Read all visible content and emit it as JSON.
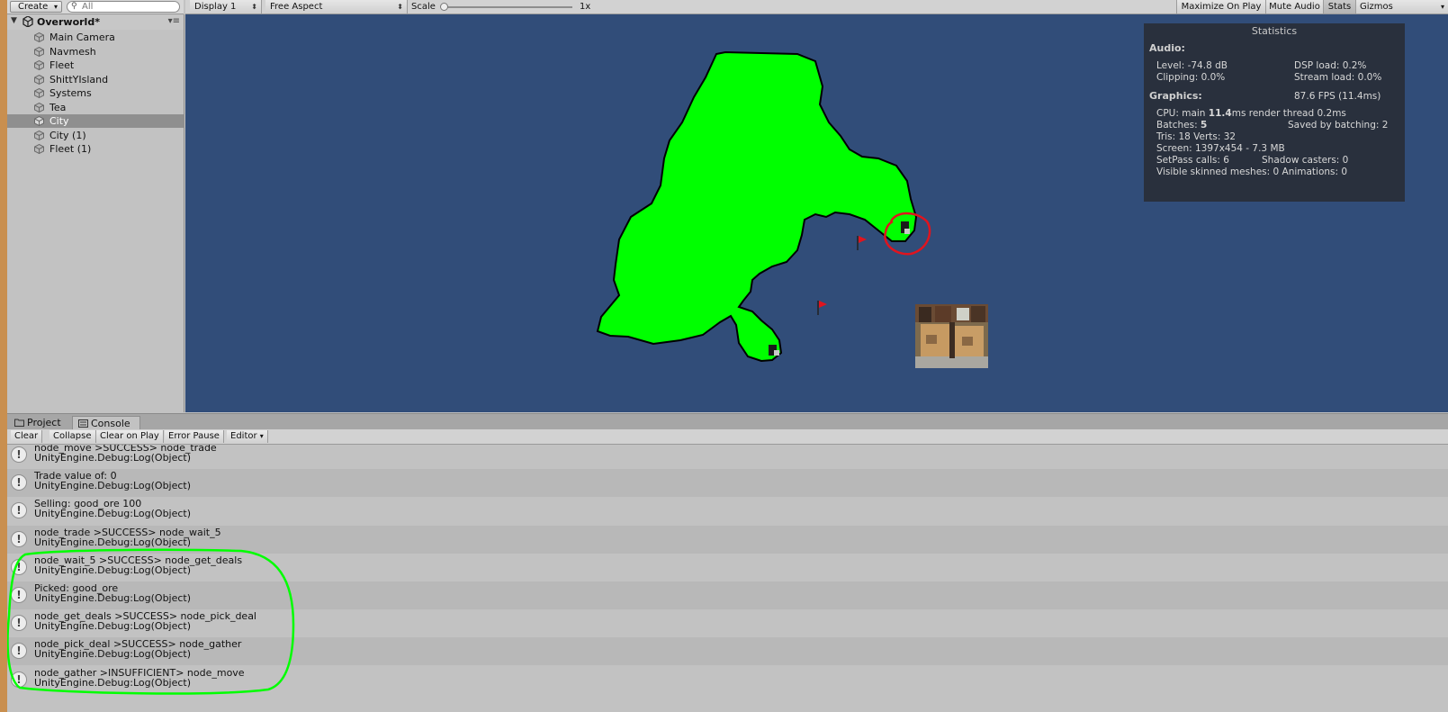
{
  "hierarchy": {
    "create_label": "Create",
    "search_placeholder": "All",
    "scene_name": "Overworld*",
    "items": [
      {
        "label": "Main Camera",
        "selected": false
      },
      {
        "label": "Navmesh",
        "selected": false
      },
      {
        "label": "Fleet",
        "selected": false
      },
      {
        "label": "ShittYIsland",
        "selected": false
      },
      {
        "label": "Systems",
        "selected": false
      },
      {
        "label": "Tea",
        "selected": false
      },
      {
        "label": "City",
        "selected": true
      },
      {
        "label": "City (1)",
        "selected": false
      },
      {
        "label": "Fleet (1)",
        "selected": false
      }
    ]
  },
  "game_toolbar": {
    "display": "Display 1",
    "aspect": "Free Aspect",
    "scale_label": "Scale",
    "scale_value": "1x",
    "maximize": "Maximize On Play",
    "mute": "Mute Audio",
    "stats": "Stats",
    "gizmos": "Gizmos"
  },
  "stats": {
    "title": "Statistics",
    "audio_header": "Audio:",
    "level": "Level: -74.8 dB",
    "dsp": "DSP load: 0.2%",
    "clipping": "Clipping: 0.0%",
    "stream": "Stream load: 0.0%",
    "graphics_header": "Graphics:",
    "fps": "87.6 FPS (11.4ms)",
    "cpu_prefix": "CPU: main ",
    "cpu_main": "11.4",
    "cpu_suffix": "ms  render thread 0.2ms",
    "batches_prefix": "Batches: ",
    "batches": "5",
    "saved_batching": "Saved by batching: 2",
    "tris": "Tris: 18   Verts: 32",
    "screen": "Screen: 1397x454 - 7.3 MB",
    "setpass": "SetPass calls: 6",
    "shadow": "Shadow casters: 0",
    "skinned": "Visible skinned meshes: 0  Animations: 0"
  },
  "bottom_tabs": {
    "project": "Project",
    "console": "Console"
  },
  "console_toolbar": {
    "clear": "Clear",
    "collapse": "Collapse",
    "clear_on_play": "Clear on Play",
    "error_pause": "Error Pause",
    "editor": "Editor"
  },
  "console": {
    "entries": [
      {
        "line1": "node_move >SUCCESS> node_trade",
        "line2": "UnityEngine.Debug:Log(Object)"
      },
      {
        "line1": "Trade value of: 0",
        "line2": "UnityEngine.Debug:Log(Object)"
      },
      {
        "line1": "Selling: good_ore 100",
        "line2": "UnityEngine.Debug:Log(Object)"
      },
      {
        "line1": "node_trade >SUCCESS> node_wait_5",
        "line2": "UnityEngine.Debug:Log(Object)"
      },
      {
        "line1": "node_wait_5 >SUCCESS> node_get_deals",
        "line2": "UnityEngine.Debug:Log(Object)"
      },
      {
        "line1": "Picked: good_ore",
        "line2": "UnityEngine.Debug:Log(Object)"
      },
      {
        "line1": "node_get_deals >SUCCESS> node_pick_deal",
        "line2": "UnityEngine.Debug:Log(Object)"
      },
      {
        "line1": "node_pick_deal >SUCCESS> node_gather",
        "line2": "UnityEngine.Debug:Log(Object)"
      },
      {
        "line1": "node_gather >INSUFFICIENT> node_move",
        "line2": "UnityEngine.Debug:Log(Object)"
      }
    ]
  },
  "colors": {
    "game_background": "#314d79",
    "island": "#00ff00",
    "annotation_red": "#e0141e",
    "annotation_green": "#00ff00"
  }
}
